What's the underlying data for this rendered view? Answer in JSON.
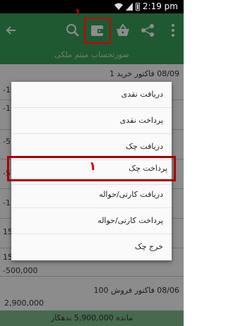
{
  "status_bar": {
    "time": "2:19 pm"
  },
  "app_bar": {
    "icons": [
      "back-arrow-icon",
      "search-icon",
      "wallet-icon",
      "basket-icon",
      "share-icon",
      "more-vert-icon"
    ],
    "highlight_number": "١"
  },
  "subtitle": "صورتحساب میثم ملکی",
  "transactions": [
    {
      "date": "08/09",
      "desc": "فاکتور خرید 1"
    },
    {
      "date": "08/06",
      "desc": "فاکتور فروش 100",
      "amount": "2,900,000"
    }
  ],
  "partial_amounts": [
    "-1",
    "-1",
    "-5",
    "-5",
    "-1",
    "15",
    "15",
    "-500,000"
  ],
  "footer": "مانده 5,900,000 بدهکار",
  "menu": {
    "items": [
      {
        "label": "دریافت نقدی"
      },
      {
        "label": "پرداخت نقدی"
      },
      {
        "label": "دریافت چک"
      },
      {
        "label": "پرداخت چک",
        "selected": true
      },
      {
        "label": "دریافت کارتی/حواله"
      },
      {
        "label": "پرداخت کارتی/حواله"
      },
      {
        "label": "خرج چک"
      }
    ],
    "highlight_number": "١"
  },
  "colors": {
    "primary": "#3aa35a",
    "footer": "#82c08f",
    "annotation": "#c00000"
  }
}
